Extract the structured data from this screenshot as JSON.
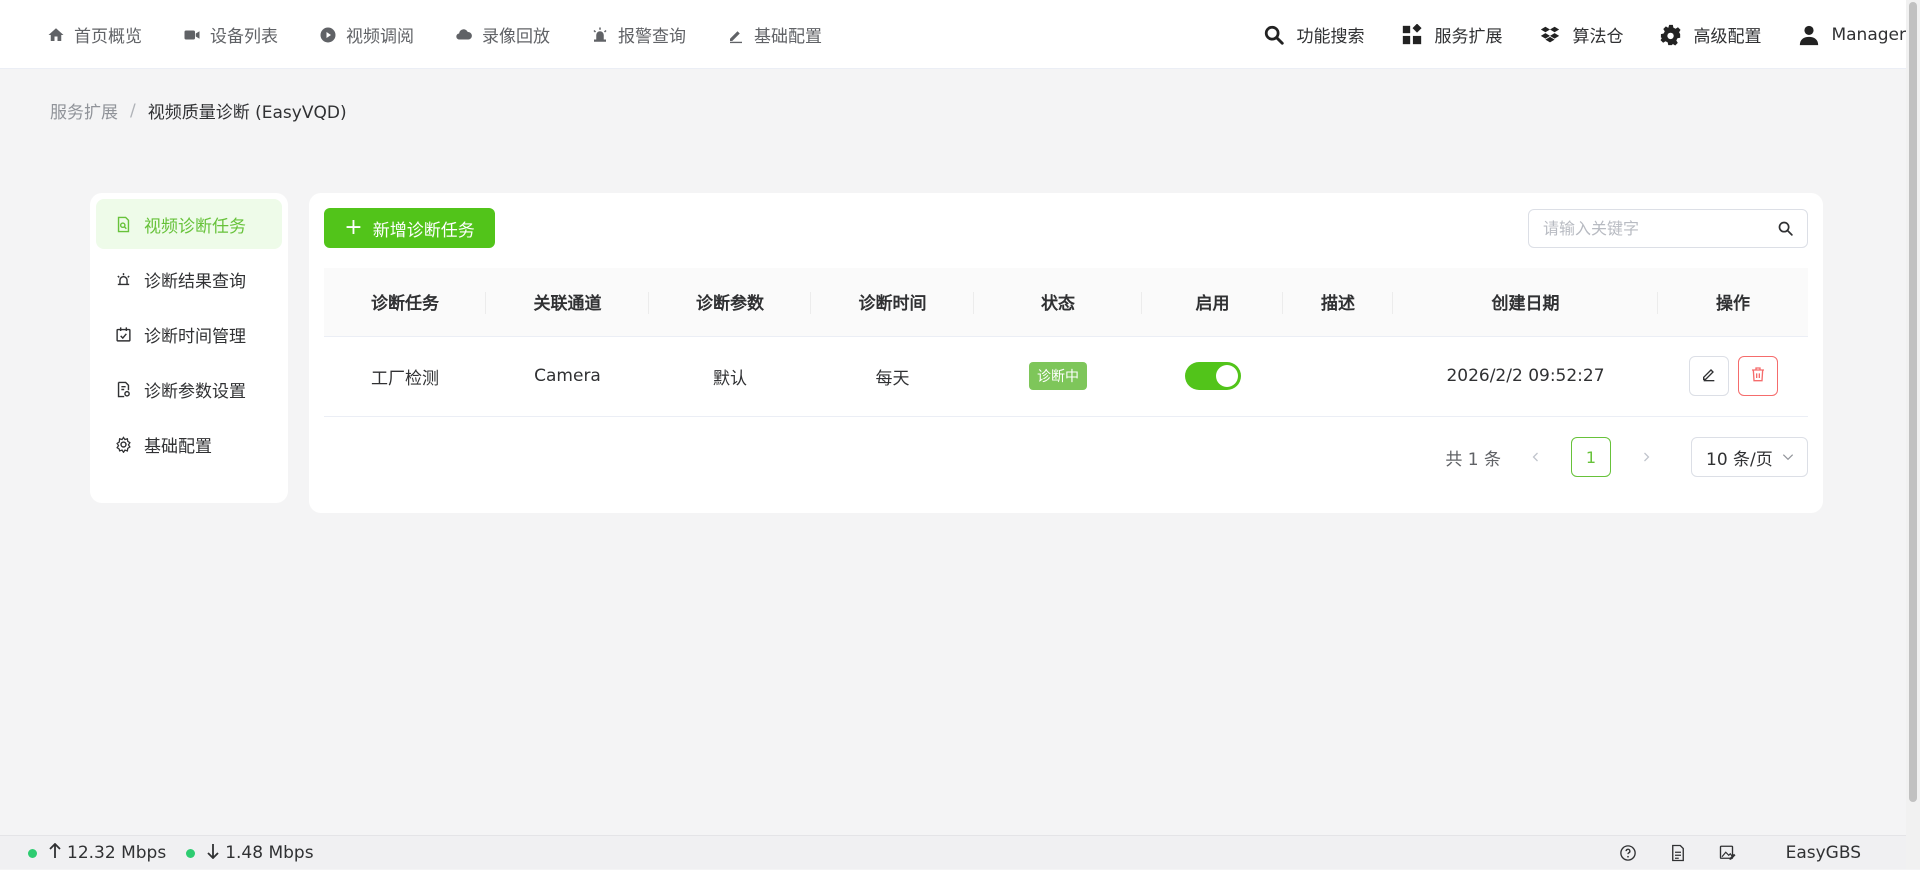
{
  "nav": {
    "left": [
      {
        "label": "首页概览",
        "icon": "home-icon"
      },
      {
        "label": "设备列表",
        "icon": "camera-icon"
      },
      {
        "label": "视频调阅",
        "icon": "play-circle-icon"
      },
      {
        "label": "录像回放",
        "icon": "cloud-icon"
      },
      {
        "label": "报警查询",
        "icon": "alarm-icon"
      },
      {
        "label": "基础配置",
        "icon": "pencil-icon"
      }
    ],
    "right": [
      {
        "label": "功能搜索",
        "icon": "search-icon"
      },
      {
        "label": "服务扩展",
        "icon": "apps-icon"
      },
      {
        "label": "算法仓",
        "icon": "dropbox-icon"
      },
      {
        "label": "高级配置",
        "icon": "gear-icon"
      },
      {
        "label": "Manager",
        "icon": "user-icon"
      }
    ]
  },
  "breadcrumb": {
    "parent": "服务扩展",
    "separator": "/",
    "current": "视频质量诊断 (EasyVQD)"
  },
  "sidebar": {
    "items": [
      {
        "label": "视频诊断任务",
        "icon": "task-doc-icon",
        "active": true
      },
      {
        "label": "诊断结果查询",
        "icon": "alarm-icon",
        "active": false
      },
      {
        "label": "诊断时间管理",
        "icon": "calendar-check-icon",
        "active": false
      },
      {
        "label": "诊断参数设置",
        "icon": "doc-settings-icon",
        "active": false
      },
      {
        "label": "基础配置",
        "icon": "gear-icon",
        "active": false
      }
    ]
  },
  "toolbar": {
    "add_label": "新增诊断任务",
    "search_placeholder": "请输入关键字"
  },
  "table": {
    "columns": [
      "诊断任务",
      "关联通道",
      "诊断参数",
      "诊断时间",
      "状态",
      "启用",
      "描述",
      "创建日期",
      "操作"
    ],
    "rows": [
      {
        "task": "工厂检测",
        "channel": "Camera",
        "params": "默认",
        "time": "每天",
        "status": "诊断中",
        "enabled": true,
        "description": "",
        "created": "2026/2/2 09:52:27"
      }
    ]
  },
  "pagination": {
    "total": "共 1 条",
    "current_page": "1",
    "page_size": "10 条/页"
  },
  "statusbar": {
    "upload": "12.32 Mbps",
    "download": "1.48 Mbps",
    "brand": "EasyGBS"
  },
  "colors": {
    "accent": "#52c41a",
    "danger": "#f56c6c",
    "status_badge": "#7ec65a"
  }
}
